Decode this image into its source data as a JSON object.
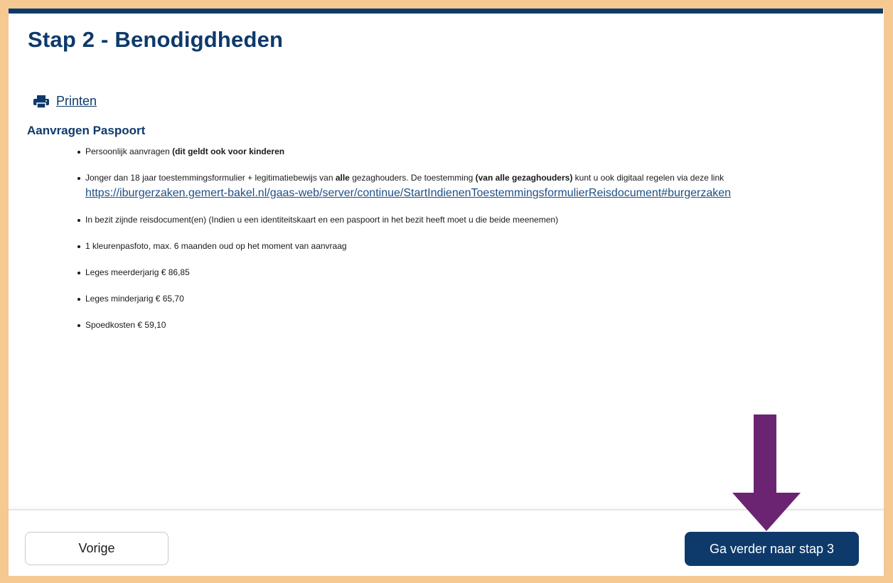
{
  "page": {
    "title": "Stap 2 - Benodigdheden",
    "print_label": "Printen",
    "section_title": "Aanvragen Paspoort"
  },
  "requirements": [
    {
      "text": "Persoonlijk aanvragen ",
      "bold": "(dit geldt ook voor kinderen"
    },
    {
      "t1": "Jonger dan 18 jaar toestemmingsformulier + legitimatiebewijs  van ",
      "b1": "alle",
      "t2": " gezaghouders. De toestemming ",
      "b2": "(van alle gezaghouders)",
      "t3": " kunt u ook digitaal regelen via deze link",
      "link": "https://iburgerzaken.gemert-bakel.nl/gaas-web/server/continue/StartIndienenToestemmingsformulierReisdocument#burgerzaken"
    },
    {
      "text": "In bezit zijnde reisdocument(en) (Indien u een identiteitskaart en een paspoort in het bezit heeft moet u die beide meenemen)"
    },
    {
      "text": "1 kleurenpasfoto, max. 6 maanden oud op het moment van aanvraag"
    },
    {
      "text": "Leges meerderjarig € 86,85"
    },
    {
      "text": "Leges minderjarig € 65,70"
    },
    {
      "text": "Spoedkosten € 59,10"
    }
  ],
  "footer": {
    "prev_label": "Vorige",
    "next_label": "Ga verder naar stap 3"
  },
  "icons": {
    "print": "printer-icon",
    "annotation": "down-arrow-icon"
  },
  "colors": {
    "brand": "#0e3a6b",
    "frame": "#f6c892",
    "arrow": "#6b2472",
    "link": "#1e4f86"
  }
}
